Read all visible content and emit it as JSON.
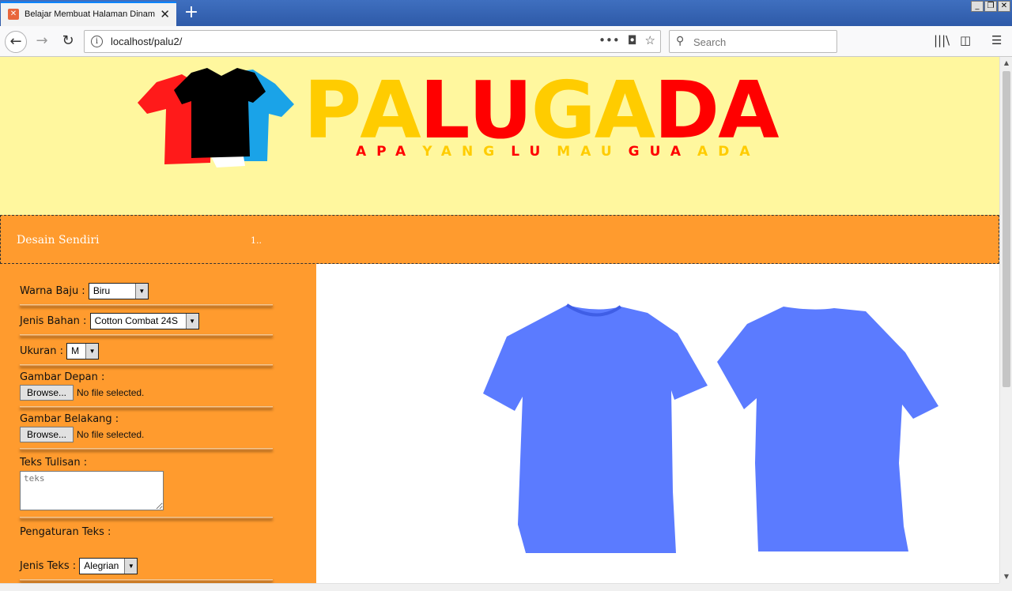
{
  "browser": {
    "tab_title": "Belajar Membuat Halaman Dinamis",
    "url": "localhost/palu2/",
    "search_placeholder": "Search"
  },
  "logo": {
    "letters": [
      {
        "char": "P",
        "color": "#ffcc00"
      },
      {
        "char": "A",
        "color": "#ffcc00"
      },
      {
        "char": "L",
        "color": "#ff0000"
      },
      {
        "char": "U",
        "color": "#ff0000"
      },
      {
        "char": "G",
        "color": "#ffcc00"
      },
      {
        "char": "A",
        "color": "#ffcc00"
      },
      {
        "char": "D",
        "color": "#ff0000"
      },
      {
        "char": "A",
        "color": "#ff0000"
      }
    ],
    "tagline": [
      {
        "text": "APA",
        "color": "#ff0000"
      },
      {
        "text": "YANG",
        "color": "#ffcc00"
      },
      {
        "text": "LU",
        "color": "#ff0000"
      },
      {
        "text": "MAU",
        "color": "#ffcc00"
      },
      {
        "text": "GUA",
        "color": "#ff0000"
      },
      {
        "text": "ADA",
        "color": "#ffcc00"
      }
    ]
  },
  "menu": {
    "link": "Desain Sendiri",
    "marker": "1.."
  },
  "form": {
    "warna_label": "Warna Baju :",
    "warna_value": "Biru",
    "bahan_label": "Jenis Bahan :",
    "bahan_value": "Cotton Combat 24S",
    "ukuran_label": "Ukuran :",
    "ukuran_value": "M",
    "depan_label": "Gambar Depan :",
    "belakang_label": "Gambar Belakang :",
    "browse_label": "Browse...",
    "nofile_label": "No file selected.",
    "teks_label": "Teks Tulisan :",
    "teks_placeholder": "teks",
    "pengaturan_label": "Pengaturan Teks :",
    "jenis_teks_label": "Jenis Teks :",
    "jenis_teks_value": "Alegrian"
  },
  "colors": {
    "banner": "#fff79e",
    "orange": "#ff9b2e",
    "shirt": "#5b7bff"
  }
}
